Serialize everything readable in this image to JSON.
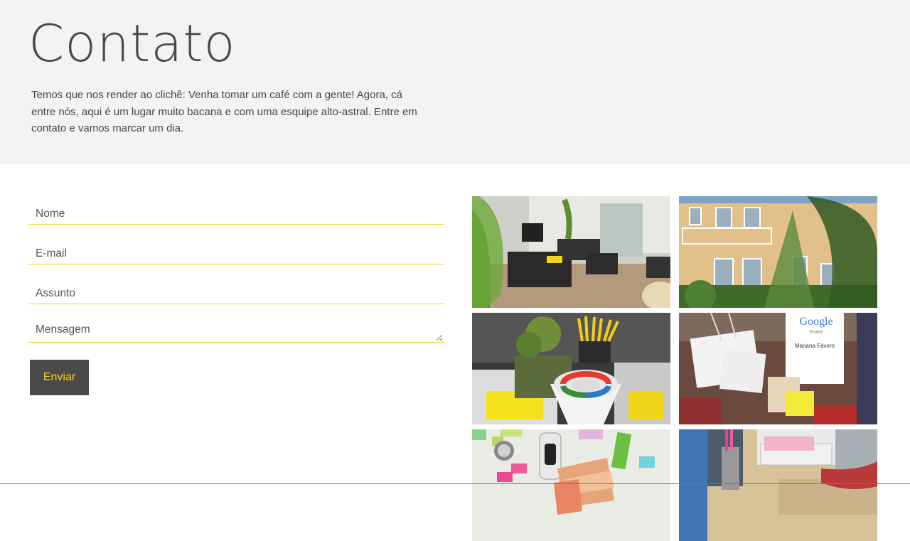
{
  "hero": {
    "title": "Contato",
    "description": "Temos que nos render ao clichê: Venha tomar um café com a gente! Agora, cá entre nós, aqui é um lugar muito bacana e com uma esquipe alto-astral. Entre em contato e vamos marcar um dia."
  },
  "form": {
    "name_placeholder": "Nome",
    "email_placeholder": "E-mail",
    "subject_placeholder": "Assunto",
    "message_placeholder": "Mensagem",
    "submit_label": "Enviar"
  },
  "gallery": {
    "photo3_badge": "Google",
    "photo3_badge_sub": "Event",
    "photo3_name": "Mariana Fávero"
  },
  "colors": {
    "hero_background": "#f3f3f3",
    "accent_yellow": "#f2d21c",
    "button_background": "#4a4a4a",
    "button_text": "#f5d321"
  }
}
